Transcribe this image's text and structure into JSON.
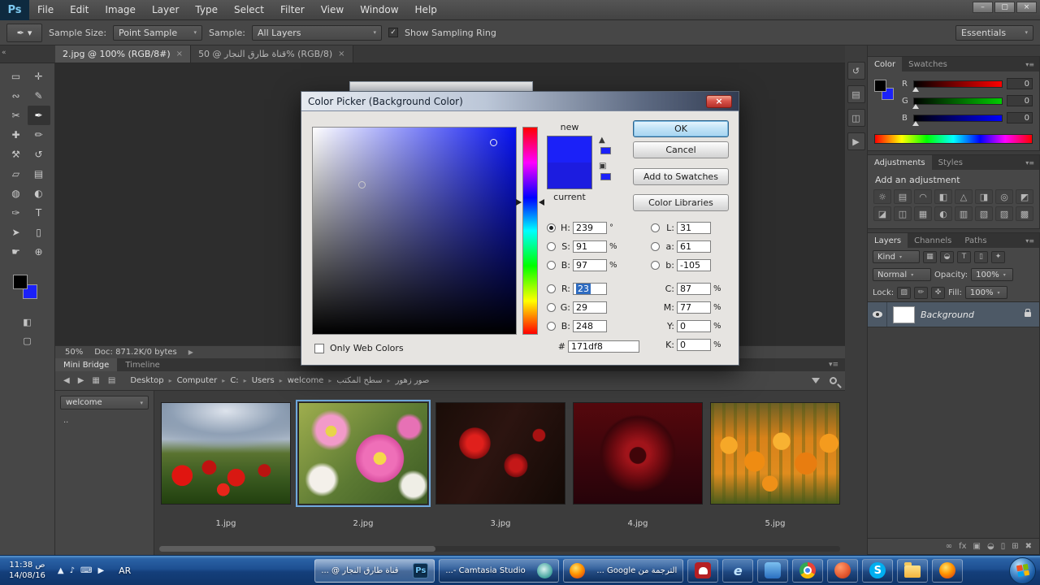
{
  "app": {
    "logo": "Ps",
    "menu": [
      "File",
      "Edit",
      "Image",
      "Layer",
      "Type",
      "Select",
      "Filter",
      "View",
      "Window",
      "Help"
    ],
    "window_controls": {
      "minimize": "–",
      "restore": "▢",
      "close": "×"
    }
  },
  "options": {
    "tool_glyph": "✒",
    "sample_size_label": "Sample Size:",
    "sample_size_value": "Point Sample",
    "sample_label": "Sample:",
    "sample_value": "All Layers",
    "check_glyph": "✓",
    "sampling_ring_label": "Show Sampling Ring",
    "workspace": "Essentials"
  },
  "tabs": {
    "tab1": "2.jpg @ 100% (RGB/8#)",
    "tab2": "قناة طارق النجار @ 50% (RGB/8)",
    "close": "×",
    "collapse_left": "«",
    "collapse_right": "«"
  },
  "tools": [
    {
      "name": "rectangular-marquee",
      "glyph": "▭"
    },
    {
      "name": "move",
      "glyph": "✛"
    },
    {
      "name": "lasso",
      "glyph": "∾"
    },
    {
      "name": "quick-selection",
      "glyph": "✎"
    },
    {
      "name": "crop",
      "glyph": "✂"
    },
    {
      "name": "eyedropper",
      "glyph": "✒"
    },
    {
      "name": "spot-healing-brush",
      "glyph": "✚"
    },
    {
      "name": "brush",
      "glyph": "✏"
    },
    {
      "name": "clone-stamp",
      "glyph": "⚒"
    },
    {
      "name": "history-brush",
      "glyph": "↺"
    },
    {
      "name": "eraser",
      "glyph": "▱"
    },
    {
      "name": "gradient",
      "glyph": "▤"
    },
    {
      "name": "blur",
      "glyph": "◍"
    },
    {
      "name": "dodge",
      "glyph": "◐"
    },
    {
      "name": "pen",
      "glyph": "✑"
    },
    {
      "name": "type",
      "glyph": "T"
    },
    {
      "name": "path-selection",
      "glyph": "➤"
    },
    {
      "name": "rectangle",
      "glyph": "▯"
    },
    {
      "name": "hand",
      "glyph": "☛"
    },
    {
      "name": "zoom",
      "glyph": "⊕"
    }
  ],
  "colors": {
    "foreground": "#000000",
    "background": "#1b21f8",
    "picker_new": "#1b21f8",
    "picker_current": "#1c1ce0"
  },
  "status": {
    "zoom": "50%",
    "doc": "Doc: 871.2K/0 bytes",
    "expand": "▶"
  },
  "picker": {
    "title": "Color Picker (Background Color)",
    "close": "×",
    "new_label": "new",
    "current_label": "current",
    "gamut_warning_glyph": "▲",
    "web_cube_glyph": "▣",
    "ok": "OK",
    "cancel": "Cancel",
    "add_to_swatches": "Add to Swatches",
    "color_libraries": "Color Libraries",
    "h_label": "H:",
    "h": "239",
    "h_unit": "°",
    "s_label": "S:",
    "s": "91",
    "s_unit": "%",
    "b_label": "B:",
    "b": "97",
    "b_unit": "%",
    "l_label": "L:",
    "l": "31",
    "a_label": "a:",
    "a": "61",
    "lab_b_label": "b:",
    "lab_b": "-105",
    "r_label": "R:",
    "r": "23",
    "g_label": "G:",
    "g": "29",
    "rgb_b_label": "B:",
    "rgb_b": "248",
    "c_label": "C:",
    "c": "87",
    "c_unit": "%",
    "m_label": "M:",
    "m": "77",
    "m_unit": "%",
    "y_label": "Y:",
    "y": "0",
    "y_unit": "%",
    "k_label": "K:",
    "k": "0",
    "k_unit": "%",
    "hex_label": "#",
    "hex": "171df8",
    "only_web": "Only Web Colors"
  },
  "strip_icons": [
    {
      "name": "history",
      "glyph": "↺"
    },
    {
      "name": "properties",
      "glyph": "▤"
    },
    {
      "name": "info",
      "glyph": "◫"
    },
    {
      "name": "actions",
      "glyph": "▶"
    }
  ],
  "color_panel": {
    "tab_color": "Color",
    "tab_swatches": "Swatches",
    "menu_glyph": "▾≡",
    "r": "R",
    "g": "G",
    "b": "B",
    "r_val": "0",
    "g_val": "0",
    "b_val": "0"
  },
  "adjustments": {
    "tab_adj": "Adjustments",
    "tab_styles": "Styles",
    "heading": "Add an adjustment",
    "icons": [
      {
        "name": "brightness-contrast",
        "glyph": "☼"
      },
      {
        "name": "levels",
        "glyph": "▤"
      },
      {
        "name": "curves",
        "glyph": "◠"
      },
      {
        "name": "exposure",
        "glyph": "◧"
      },
      {
        "name": "vibrance",
        "glyph": "△"
      },
      {
        "name": "hue-saturation",
        "glyph": "◨"
      },
      {
        "name": "color-balance",
        "glyph": "◎"
      },
      {
        "name": "black-white",
        "glyph": "◩"
      },
      {
        "name": "photo-filter",
        "glyph": "◪"
      },
      {
        "name": "channel-mixer",
        "glyph": "◫"
      },
      {
        "name": "color-lookup",
        "glyph": "▦"
      },
      {
        "name": "invert",
        "glyph": "◐"
      },
      {
        "name": "posterize",
        "glyph": "▥"
      },
      {
        "name": "threshold",
        "glyph": "▧"
      },
      {
        "name": "gradient-map",
        "glyph": "▨"
      },
      {
        "name": "selective-color",
        "glyph": "▩"
      }
    ]
  },
  "layers": {
    "tab_layers": "Layers",
    "tab_channels": "Channels",
    "tab_paths": "Paths",
    "kind": "Kind",
    "filter_icons": [
      {
        "name": "filter-pixel",
        "glyph": "▦"
      },
      {
        "name": "filter-adjustment",
        "glyph": "◒"
      },
      {
        "name": "filter-type",
        "glyph": "T"
      },
      {
        "name": "filter-shape",
        "glyph": "▯"
      },
      {
        "name": "filter-smart",
        "glyph": "✦"
      }
    ],
    "blend": "Normal",
    "opacity_label": "Opacity:",
    "opacity": "100%",
    "lock_label": "Lock:",
    "lock_icons": [
      {
        "name": "lock-transparency",
        "glyph": "▨"
      },
      {
        "name": "lock-pixels",
        "glyph": "✏"
      },
      {
        "name": "lock-position",
        "glyph": "✜"
      }
    ],
    "fill_label": "Fill:",
    "fill": "100%",
    "layer_name": "Background",
    "bottom_icons": [
      {
        "name": "link-layers",
        "glyph": "∞"
      },
      {
        "name": "layer-style",
        "glyph": "fx"
      },
      {
        "name": "layer-mask",
        "glyph": "▣"
      },
      {
        "name": "adjustment-layer",
        "glyph": "◒"
      },
      {
        "name": "layer-group",
        "glyph": "▯"
      },
      {
        "name": "new-layer",
        "glyph": "⊞"
      },
      {
        "name": "delete-layer",
        "glyph": "✖"
      }
    ]
  },
  "bridge": {
    "tab_mb": "Mini Bridge",
    "tab_tl": "Timeline",
    "menu_glyph": "▾≡",
    "nav_back": "◀",
    "nav_forward": "▶",
    "view_grid": "▦",
    "view_list": "▤",
    "crumbs": [
      "Desktop",
      "Computer",
      "C:",
      "Users",
      "welcome",
      "سطح المكتب",
      "صور زهور"
    ],
    "sep": "▸",
    "pod": "welcome",
    "pod_arrow": "▾",
    "pod_item": "..",
    "files": [
      "1.jpg",
      "2.jpg",
      "3.jpg",
      "4.jpg",
      "5.jpg"
    ]
  },
  "taskbar": {
    "time": "11:38 ص",
    "date": "14/08/16",
    "tray": [
      {
        "name": "hidden-icons",
        "glyph": "▲"
      },
      {
        "name": "volume",
        "glyph": "♪"
      },
      {
        "name": "keyboard",
        "glyph": "⌨"
      },
      {
        "name": "recorder",
        "glyph": "▶"
      }
    ],
    "lang": "AR",
    "btn_ps": "... @ قناة طارق النجار",
    "btn_camtasia": "...- Camtasia Studio",
    "btn_google": "الترجمة من Google ...",
    "ps_badge": "Ps",
    "ie_glyph": "e",
    "skype_glyph": "S"
  }
}
